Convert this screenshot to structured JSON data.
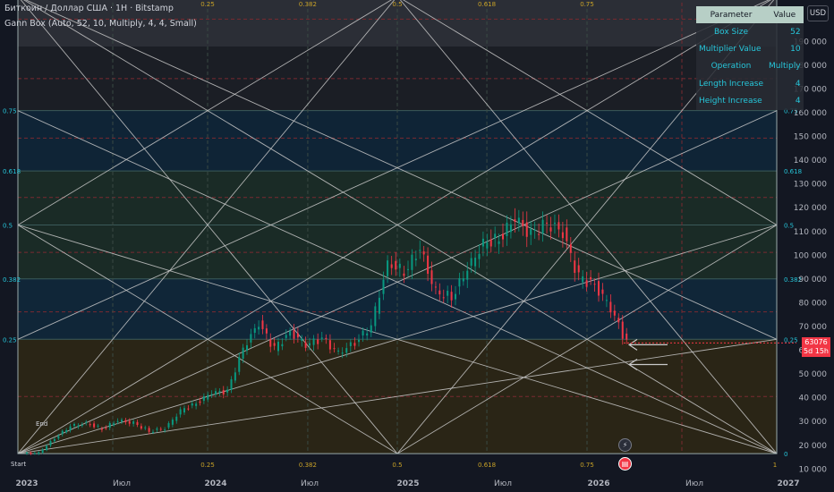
{
  "header": {
    "title": "Биткоин / Доллар США · 1Н · Bitstamp",
    "indicator": "Gann Box (Auto, 52, 10, Multiply, 4, 4, Small)"
  },
  "currency_button": "USD",
  "param_table": {
    "headers": [
      "Parameter",
      "Value"
    ],
    "rows": [
      {
        "name": "Box Size",
        "value": "52"
      },
      {
        "name": "Multiplier Value",
        "value": "10"
      },
      {
        "name": "Operation",
        "value": "Multiply"
      },
      {
        "name": "Length Increase",
        "value": "4"
      },
      {
        "name": "Height Increase",
        "value": "4"
      }
    ]
  },
  "price_tag": {
    "price": "63076",
    "countdown": "5d 15h"
  },
  "icons": {
    "flash": "lightning-icon",
    "news": "news-icon"
  },
  "labels": {
    "start": "Start",
    "end": "End"
  },
  "colors": {
    "bg": "#131722",
    "up": "#089981",
    "down": "#f23645",
    "band_top": "#2b2e36",
    "band_blue": "#0f2436",
    "band_green": "#1a2b26",
    "band_blue2": "#102638",
    "band_brown": "#2a2516",
    "gann_line": "#c9c9c9",
    "level_label": "#26c6da",
    "table_header": "#b7cfc6",
    "table_text": "#26c6da"
  },
  "chart_data": {
    "type": "candlestick",
    "title": "Биткоин / Доллар США · 1Н · Bitstamp",
    "x_ticks": [
      "2023",
      "Июл",
      "2024",
      "Июл",
      "2025",
      "Июл",
      "2026",
      "Июл",
      "2027"
    ],
    "y_ticks": [
      190000,
      180000,
      170000,
      160000,
      150000,
      140000,
      130000,
      120000,
      110000,
      100000,
      90000,
      80000,
      70000,
      60000,
      50000,
      40000,
      30000,
      20000,
      10000
    ],
    "ylim": [
      10000,
      200000
    ],
    "xlim": [
      "2023-01",
      "2027-01"
    ],
    "gann_levels": [
      0,
      0.25,
      0.382,
      0.5,
      0.618,
      0.75,
      1
    ],
    "gann_top_labels": [
      "0.25",
      "0.382",
      "0.5",
      "0.618",
      "0.75"
    ],
    "gann_bottom_labels": [
      "0.25",
      "0.382",
      "0.5",
      "0.618",
      "0.75",
      "1"
    ],
    "gann_left_labels": [
      "0.75",
      "0.618",
      "0.5",
      "0.382",
      "0.25"
    ],
    "gann_right_labels": [
      "0.75",
      "0.618",
      "0.5",
      "0.382",
      "0.25",
      "0"
    ],
    "gann_box": {
      "price_low": 16500,
      "price_high": 209000,
      "start": "2023-01",
      "end": "2026-12"
    },
    "weekly_close_series": [
      {
        "date": "2023-01",
        "close": 16800
      },
      {
        "date": "2023-02",
        "close": 23000
      },
      {
        "date": "2023-03",
        "close": 28000
      },
      {
        "date": "2023-04",
        "close": 29200
      },
      {
        "date": "2023-05",
        "close": 27000
      },
      {
        "date": "2023-06",
        "close": 30400
      },
      {
        "date": "2023-07",
        "close": 29300
      },
      {
        "date": "2023-08",
        "close": 26000
      },
      {
        "date": "2023-09",
        "close": 27000
      },
      {
        "date": "2023-10",
        "close": 34500
      },
      {
        "date": "2023-11",
        "close": 37700
      },
      {
        "date": "2023-12",
        "close": 42300
      },
      {
        "date": "2024-01",
        "close": 42500
      },
      {
        "date": "2024-02",
        "close": 61000
      },
      {
        "date": "2024-03",
        "close": 71300
      },
      {
        "date": "2024-04",
        "close": 60600
      },
      {
        "date": "2024-05",
        "close": 67500
      },
      {
        "date": "2024-06",
        "close": 62700
      },
      {
        "date": "2024-07",
        "close": 64600
      },
      {
        "date": "2024-08",
        "close": 58900
      },
      {
        "date": "2024-09",
        "close": 63300
      },
      {
        "date": "2024-10",
        "close": 70200
      },
      {
        "date": "2024-11",
        "close": 96400
      },
      {
        "date": "2024-12",
        "close": 93400
      },
      {
        "date": "2025-01",
        "close": 102400
      },
      {
        "date": "2025-02",
        "close": 84300
      },
      {
        "date": "2025-03",
        "close": 82500
      },
      {
        "date": "2025-04",
        "close": 94200
      },
      {
        "date": "2025-05",
        "close": 104600
      },
      {
        "date": "2025-06",
        "close": 107100
      },
      {
        "date": "2025-07",
        "close": 115700
      },
      {
        "date": "2025-08",
        "close": 108200
      },
      {
        "date": "2025-09",
        "close": 114000
      },
      {
        "date": "2025-10",
        "close": 109500
      },
      {
        "date": "2025-11",
        "close": 90400
      },
      {
        "date": "2025-12",
        "close": 87500
      },
      {
        "date": "2026-01",
        "close": 78000
      },
      {
        "date": "2026-02",
        "close": 63076
      }
    ],
    "last_price": 63076
  }
}
